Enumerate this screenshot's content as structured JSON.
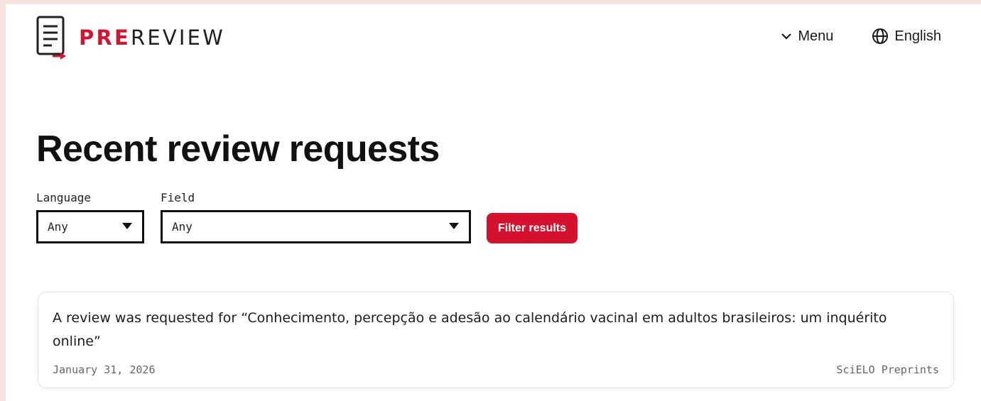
{
  "header": {
    "logo_pre": "PRE",
    "logo_rest": "REVIEW",
    "menu_label": "Menu",
    "language_label": "English"
  },
  "page": {
    "title": "Recent review requests"
  },
  "filters": {
    "language": {
      "label": "Language",
      "value": "Any"
    },
    "field": {
      "label": "Field",
      "value": "Any"
    },
    "submit_label": "Filter results"
  },
  "requests": [
    {
      "text": "A review was requested for “Conhecimento, percepção e adesão ao calendário vacinal em adultos brasileiros: um inquérito online”",
      "date": "January 31, 2026",
      "source": "SciELO Preprints"
    }
  ],
  "colors": {
    "accent": "#d4112f",
    "page_background": "#f6e3df"
  },
  "icons": {
    "logo": "document-arrow-icon",
    "menu": "chevron-down-icon",
    "language": "globe-icon"
  }
}
